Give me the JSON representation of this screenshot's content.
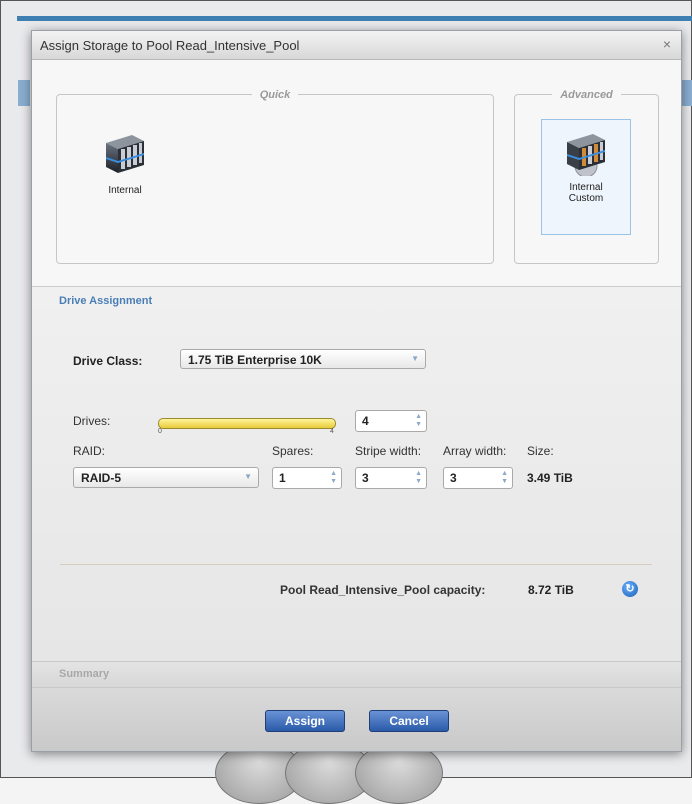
{
  "dialog": {
    "title": "Assign Storage to Pool Read_Intensive_Pool",
    "close_label": "×"
  },
  "quick": {
    "legend": "Quick",
    "tiles": [
      {
        "label": "Internal",
        "icon": "server-icon"
      }
    ]
  },
  "advanced": {
    "legend": "Advanced",
    "tiles": [
      {
        "label_line1": "Internal",
        "label_line2": "Custom",
        "icon": "server-gear-icon",
        "selected": true
      }
    ]
  },
  "drive_assignment": {
    "section_label": "Drive Assignment",
    "drive_class_label": "Drive Class:",
    "drive_class_value": "1.75 TiB Enterprise 10K",
    "drives_label": "Drives:",
    "drives_slider": {
      "min": "0",
      "max": "4",
      "fill_fraction": 1.0
    },
    "drives_value": "4",
    "raid_label": "RAID:",
    "raid_value": "RAID-5",
    "spares_label": "Spares:",
    "spares_value": "1",
    "stripe_width_label": "Stripe width:",
    "stripe_width_value": "3",
    "array_width_label": "Array width:",
    "array_width_value": "3",
    "size_label": "Size:",
    "size_value": "3.49 TiB",
    "capacity_label": "Pool Read_Intensive_Pool capacity:",
    "capacity_value": "8.72 TiB"
  },
  "summary": {
    "label": "Summary"
  },
  "buttons": {
    "assign": "Assign",
    "cancel": "Cancel"
  },
  "colors": {
    "accent": "#4a7fb6",
    "button": "#2a5aa8",
    "slider": "#f0d94a"
  }
}
